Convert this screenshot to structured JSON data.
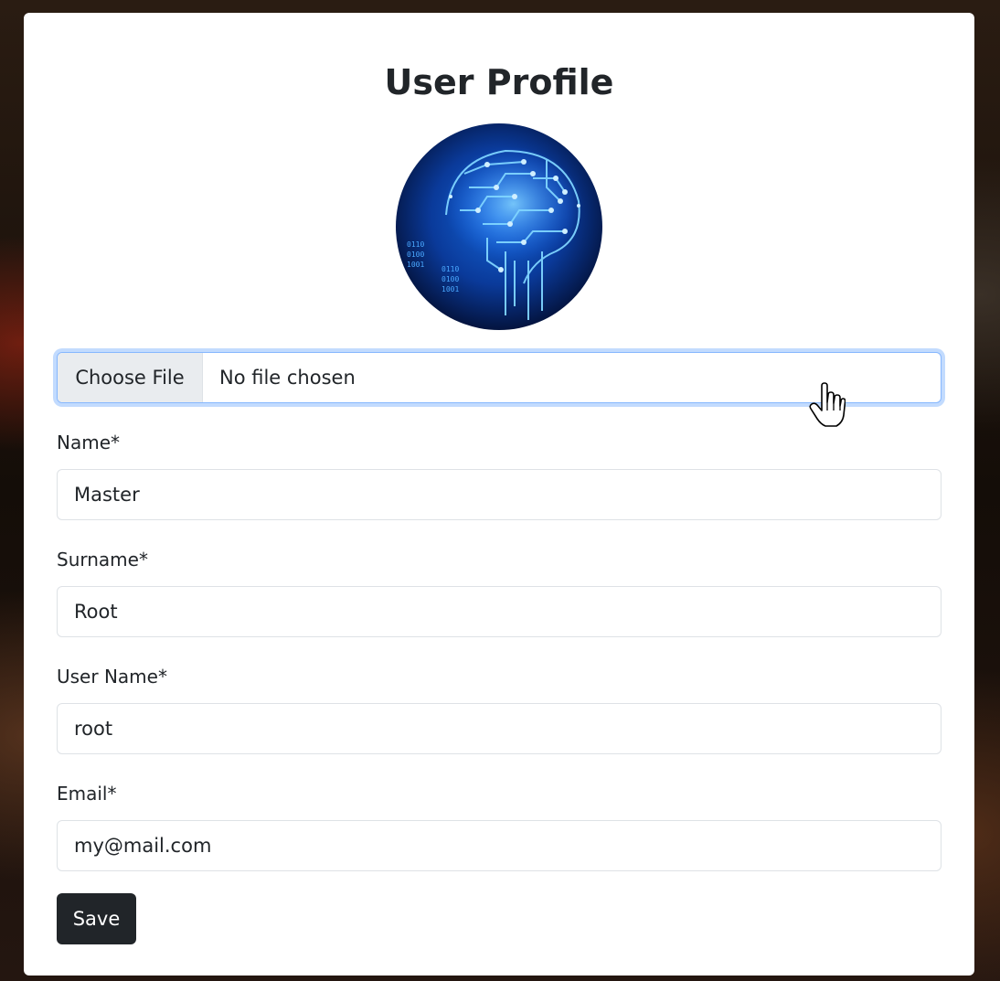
{
  "page": {
    "title": "User Profile"
  },
  "avatar": {
    "icon": "circuit-brain-image",
    "binary_text": [
      "0110",
      "0100",
      "1001",
      "0110",
      "0100",
      "1001"
    ]
  },
  "file_input": {
    "button_label": "Choose File",
    "status_text": "No file chosen"
  },
  "form": {
    "name": {
      "label": "Name*",
      "value": "Master"
    },
    "surname": {
      "label": "Surname*",
      "value": "Root"
    },
    "username": {
      "label": "User Name*",
      "value": "root"
    },
    "email": {
      "label": "Email*",
      "value": "my@mail.com"
    }
  },
  "actions": {
    "save_label": "Save"
  },
  "colors": {
    "primary_dark": "#212529",
    "focus_border": "#86b7fe",
    "file_button_bg": "#e9ecef",
    "input_border": "#dee2e6",
    "avatar_glow": "#3aa0ff"
  }
}
